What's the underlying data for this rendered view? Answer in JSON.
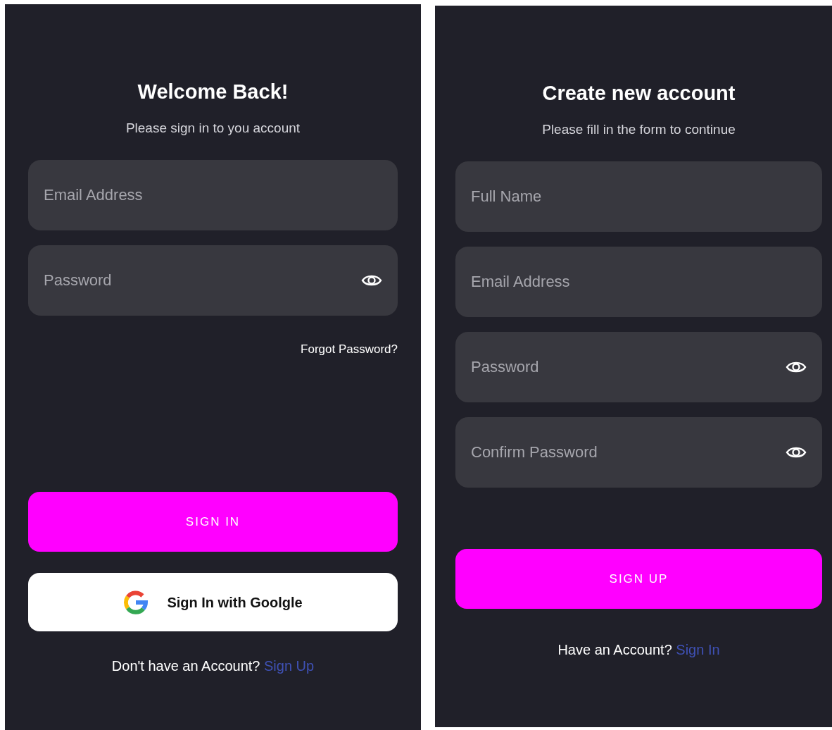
{
  "screens": [
    {
      "title": "Welcome Back!",
      "subtitle": "Please sign in to you account",
      "fields": [
        {
          "kind": "text",
          "placeholder": "Email Address"
        },
        {
          "kind": "password",
          "placeholder": "Password"
        }
      ],
      "forgot_link": "Forgot Password?",
      "primary_button": "SIGN IN",
      "google_button": "Sign In with Goolgle",
      "footer": {
        "text": "Don't have an Account?",
        "link": "Sign Up"
      }
    },
    {
      "title": "Create new account",
      "subtitle": "Please fill in the form to continue",
      "fields": [
        {
          "kind": "text",
          "placeholder": "Full Name"
        },
        {
          "kind": "text",
          "placeholder": "Email Address"
        },
        {
          "kind": "password",
          "placeholder": "Password"
        },
        {
          "kind": "password",
          "placeholder": "Confirm Password"
        }
      ],
      "primary_button": "SIGN UP",
      "footer": {
        "text": "Have an Account?",
        "link": "Sign In"
      }
    }
  ]
}
